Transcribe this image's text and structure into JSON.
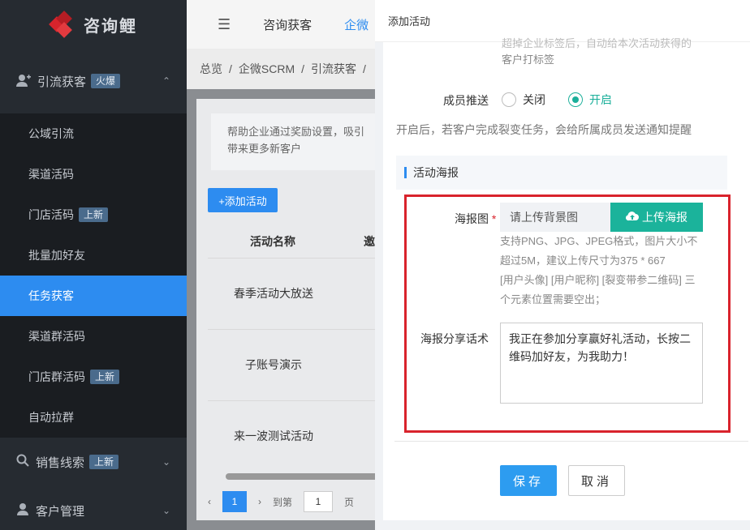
{
  "app": {
    "name": "咨询鲤"
  },
  "sidebar": {
    "group1": {
      "label": "引流获客",
      "badge": "火爆"
    },
    "items": [
      {
        "label": "公域引流"
      },
      {
        "label": "渠道活码"
      },
      {
        "label": "门店活码",
        "badge": "上新"
      },
      {
        "label": "批量加好友"
      },
      {
        "label": "任务获客",
        "active": true
      },
      {
        "label": "渠道群活码"
      },
      {
        "label": "门店群活码",
        "badge": "上新"
      },
      {
        "label": "自动拉群"
      }
    ],
    "group2": {
      "label": "销售线索",
      "badge": "上新"
    },
    "group3": {
      "label": "客户管理"
    }
  },
  "topbar": {
    "tab1": "咨询获客",
    "tab2": "企微"
  },
  "breadcrumb": {
    "items": [
      "总览",
      "企微SCRM",
      "引流获客"
    ]
  },
  "main": {
    "tip": "帮助企业通过奖励设置，吸引客户带来更多新客户",
    "tip_line1": "帮助企业通过奖励设置，吸引",
    "tip_line2": "带来更多新客户",
    "add_button": "+添加活动",
    "columns": [
      "活动名称",
      "邀"
    ],
    "rows": [
      "春季活动大放送",
      "子账号演示",
      "来一波测试活动"
    ],
    "pager": {
      "page": "1",
      "goto_label": "到第",
      "goto_value": "1",
      "page_suffix": "页"
    }
  },
  "drawer": {
    "title": "添加活动",
    "faded_text": "超掉企业标签后，自动给本次活动获得的客户打标签",
    "faded_line1": "超掉企业标签后，自动给本次活动获得的",
    "faded_line2": "客户打标签",
    "member_push": {
      "label": "成员推送",
      "off": "关闭",
      "on": "开启",
      "selected": "开启"
    },
    "hint": "开启后，若客户完成裂变任务，会给所属成员发送通知提醒",
    "section_title": "活动海报",
    "poster": {
      "label": "海报图",
      "required_mark": "*",
      "placeholder": "请上传背景图",
      "upload_button": "上传海报",
      "tip1": "支持PNG、JPG、JPEG格式，图片大小不",
      "tip2": "超过5M，建议上传尺寸为375 * 667",
      "tip3": "[用户头像] [用户昵称] [裂变带参二维码] 三",
      "tip4": "个元素位置需要空出；"
    },
    "share": {
      "label": "海报分享话术",
      "value": "我正在参加分享赢好礼活动，长按二维码加好友，为我助力！"
    },
    "save": "保存",
    "cancel": "取消"
  },
  "colors": {
    "accent": "#2d8cf0",
    "teal": "#1bb39b",
    "highlight": "#d9232c"
  }
}
